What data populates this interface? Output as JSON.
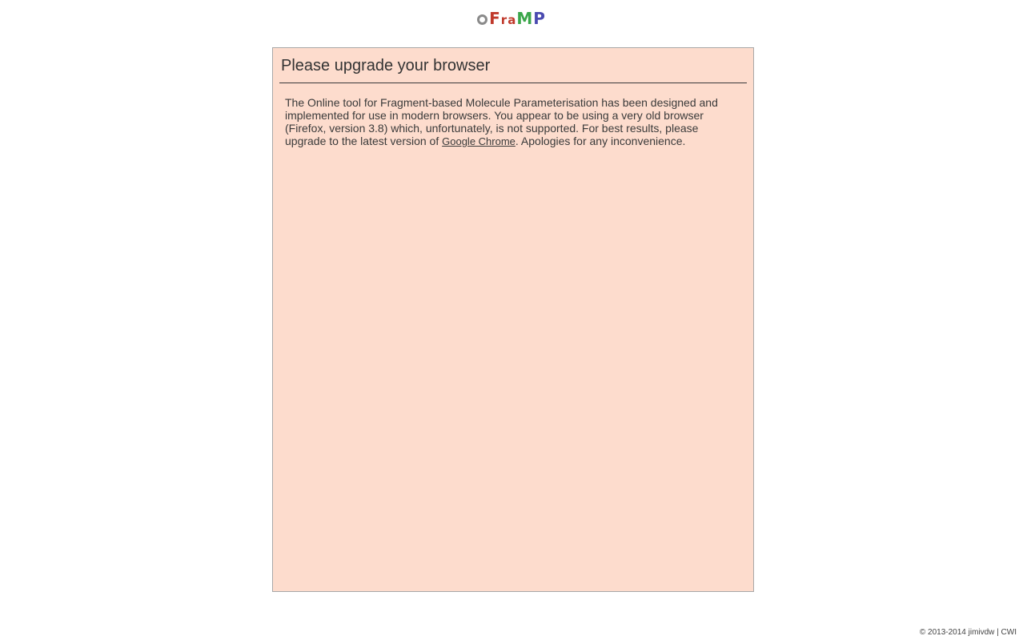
{
  "logo": {
    "letters": [
      "O",
      "F",
      "r",
      "a",
      "M",
      "P"
    ],
    "colors": {
      "o": "#8a8a8a",
      "f": "#c0392b",
      "r": "#c0392b",
      "a": "#c0392b",
      "m": "#3aa64a",
      "p": "#4a4ab0"
    }
  },
  "panel": {
    "title": "Please upgrade your browser",
    "background": "#fddccd",
    "message_part1": "The Online tool for Fragment-based Molecule Parameterisation has been designed and implemented for use in modern browsers. You appear to be using a very old browser (Firefox, version 3.8) which, unfortunately, is not supported. For best results, please upgrade to the latest version of ",
    "link_text": "Google Chrome",
    "message_part2": ". Apologies for any inconvenience."
  },
  "footer": {
    "text": "© 2013-2014 jimivdw | CWI"
  }
}
